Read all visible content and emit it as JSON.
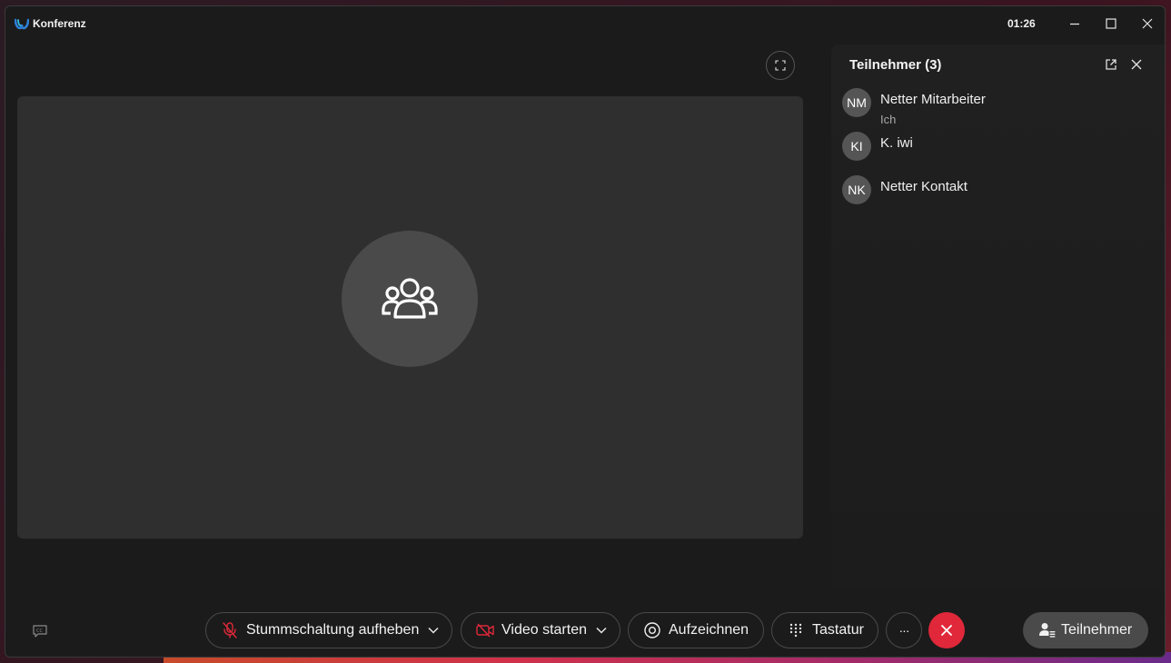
{
  "window": {
    "app_title": "Konferenz",
    "clock": "01:26"
  },
  "panel": {
    "title": "Teilnehmer (3)",
    "participants": [
      {
        "initials": "NM",
        "name": "Netter Mitarbeiter",
        "subtitle": "Ich"
      },
      {
        "initials": "KI",
        "name": "K. iwi",
        "subtitle": ""
      },
      {
        "initials": "NK",
        "name": "Netter Kontakt",
        "subtitle": ""
      }
    ]
  },
  "controls": {
    "mute_label": "Stummschaltung aufheben",
    "video_label": "Video starten",
    "record_label": "Aufzeichnen",
    "keypad_label": "Tastatur",
    "more_label": "···",
    "participants_label": "Teilnehmer"
  },
  "icons": {
    "logo": "webex-logo-icon",
    "mic": "mic-off-icon",
    "video": "video-off-icon",
    "record": "record-icon",
    "keypad": "keypad-icon",
    "end": "close-icon",
    "participants": "person-list-icon",
    "captions": "closed-captions-icon",
    "fullscreen": "fullscreen-icon",
    "group": "people-group-icon"
  },
  "colors": {
    "end_call": "#e0283a",
    "muted_icon": "#e0283a",
    "window_bg": "#1b1b1b",
    "stage_bg": "#2f2f2f"
  }
}
